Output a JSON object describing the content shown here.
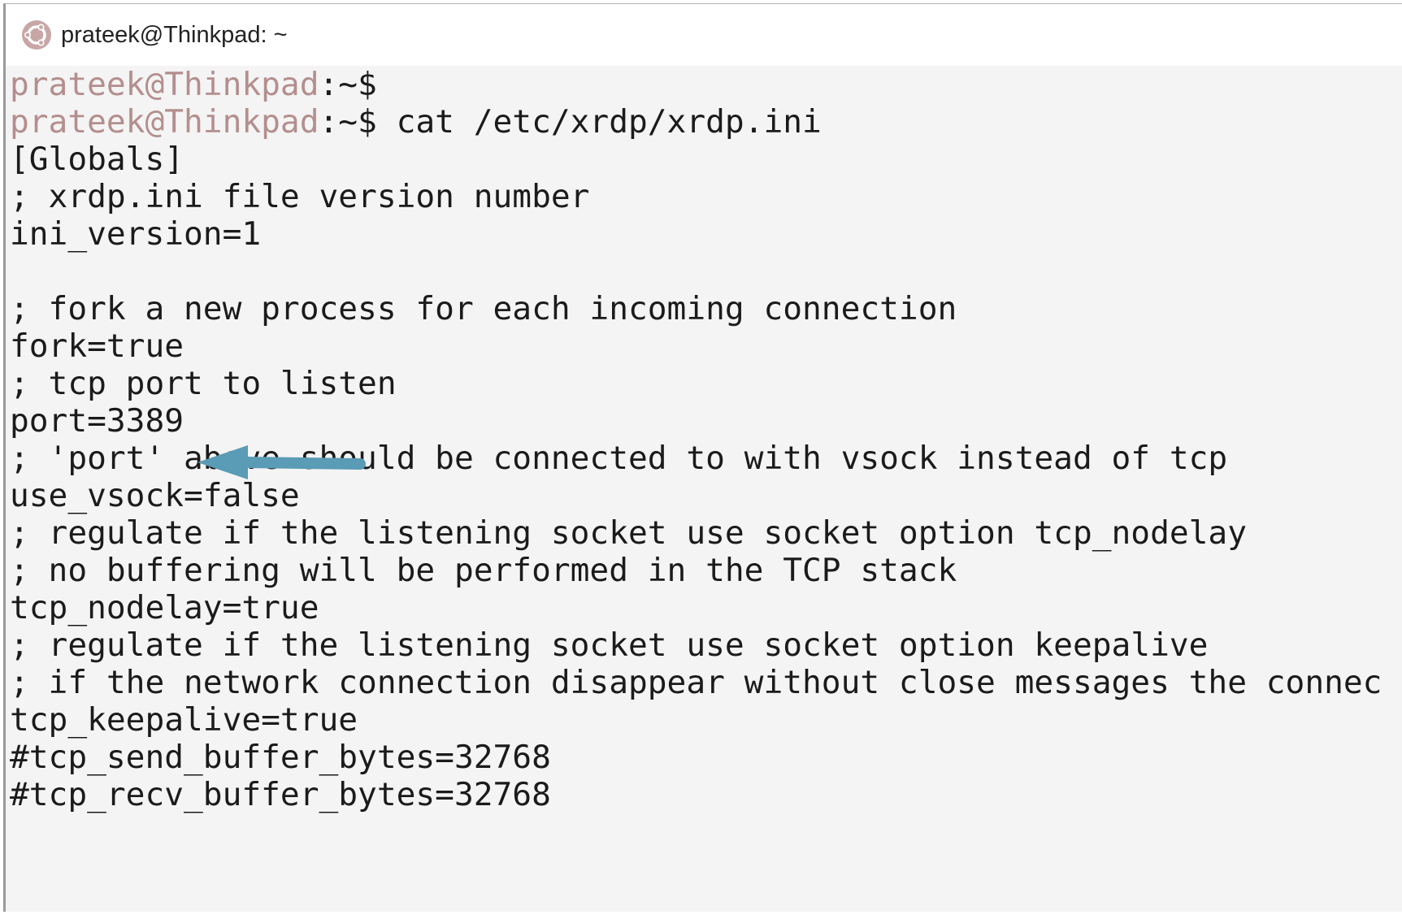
{
  "window": {
    "title": "prateek@Thinkpad: ~",
    "icon": "ubuntu-terminal-icon",
    "accent_color": "#c9a6a6"
  },
  "terminal": {
    "prompt_user": "prateek@Thinkpad",
    "prompt_suffix": ":~$",
    "lines": [
      {
        "type": "prompt",
        "command": ""
      },
      {
        "type": "prompt",
        "command": " cat /etc/xrdp/xrdp.ini"
      },
      {
        "type": "output",
        "text": "[Globals]"
      },
      {
        "type": "output",
        "text": "; xrdp.ini file version number"
      },
      {
        "type": "output",
        "text": "ini_version=1"
      },
      {
        "type": "output",
        "text": ""
      },
      {
        "type": "output",
        "text": "; fork a new process for each incoming connection"
      },
      {
        "type": "output",
        "text": "fork=true"
      },
      {
        "type": "output",
        "text": "; tcp port to listen"
      },
      {
        "type": "output",
        "text": "port=3389"
      },
      {
        "type": "output",
        "text": "; 'port' above should be connected to with vsock instead of tcp"
      },
      {
        "type": "output",
        "text": "use_vsock=false"
      },
      {
        "type": "output",
        "text": "; regulate if the listening socket use socket option tcp_nodelay"
      },
      {
        "type": "output",
        "text": "; no buffering will be performed in the TCP stack"
      },
      {
        "type": "output",
        "text": "tcp_nodelay=true"
      },
      {
        "type": "output",
        "text": "; regulate if the listening socket use socket option keepalive"
      },
      {
        "type": "output",
        "text": "; if the network connection disappear without close messages the connec"
      },
      {
        "type": "output",
        "text": "tcp_keepalive=true"
      },
      {
        "type": "output",
        "text": "#tcp_send_buffer_bytes=32768"
      },
      {
        "type": "output",
        "text": "#tcp_recv_buffer_bytes=32768"
      }
    ]
  },
  "annotation": {
    "arrow_color": "#5a9bb5",
    "points_to": "port=3389"
  },
  "colors": {
    "prompt_user": "#b48e8e",
    "text": "#1b1b1b",
    "background": "#f4f4f4"
  }
}
